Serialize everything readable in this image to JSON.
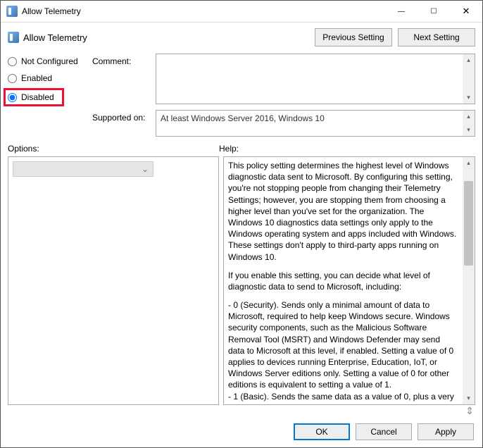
{
  "window": {
    "title": "Allow Telemetry"
  },
  "header": {
    "title": "Allow Telemetry",
    "prev": "Previous Setting",
    "next": "Next Setting"
  },
  "state": {
    "not_configured": "Not Configured",
    "enabled": "Enabled",
    "disabled": "Disabled",
    "selected": "disabled"
  },
  "fields": {
    "comment_label": "Comment:",
    "comment_value": "",
    "supported_label": "Supported on:",
    "supported_value": "At least Windows Server 2016, Windows 10"
  },
  "sections": {
    "options": "Options:",
    "help": "Help:"
  },
  "help": {
    "p1": "This policy setting determines the highest level of Windows diagnostic data sent to Microsoft. By configuring this setting, you're not stopping people from changing their Telemetry Settings; however, you are stopping them from choosing a higher level than you've set for the organization. The Windows 10 diagnostics data settings only apply to the Windows operating system and apps included with Windows. These settings don't apply to third-party apps running on Windows 10.",
    "p2": "If you enable this setting, you can decide what level of diagnostic data to send to Microsoft, including:",
    "p3": "  - 0 (Security). Sends only a minimal amount of data to Microsoft, required to help keep Windows secure. Windows security components, such as the Malicious Software Removal Tool (MSRT) and Windows Defender may send data to Microsoft at this level, if enabled. Setting a value of 0 applies to devices running Enterprise, Education, IoT, or Windows Server editions only. Setting a value of 0 for other editions is equivalent to setting a value of 1.",
    "p4": "  - 1 (Basic). Sends the same data as a value of 0, plus a very"
  },
  "buttons": {
    "ok": "OK",
    "cancel": "Cancel",
    "apply": "Apply"
  },
  "icons": {
    "chevron_down": "⌄",
    "up": "▴",
    "down": "▾"
  }
}
